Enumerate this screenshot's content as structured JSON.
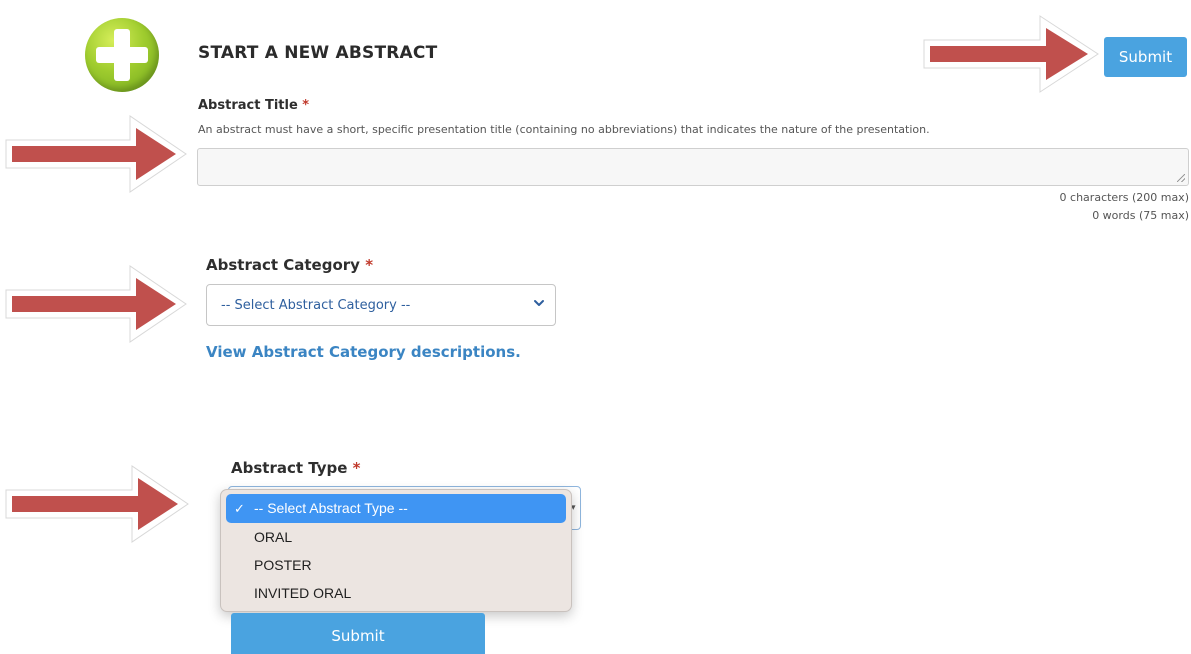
{
  "header": {
    "title": "START A NEW ABSTRACT",
    "submit_label": "Submit"
  },
  "abstract_title": {
    "label": "Abstract Title",
    "required_mark": "*",
    "help": "An abstract must have a short, specific presentation title (containing no abbreviations) that indicates the nature of the presentation.",
    "value": "",
    "char_count": "0 characters (200 max)",
    "word_count": "0 words (75 max)"
  },
  "abstract_category": {
    "label": "Abstract Category",
    "required_mark": "*",
    "selected": "-- Select Abstract Category --",
    "link": "View Abstract Category descriptions."
  },
  "abstract_type": {
    "label": "Abstract Type",
    "required_mark": "*",
    "options": [
      {
        "label": "-- Select Abstract Type --",
        "selected": true
      },
      {
        "label": "ORAL",
        "selected": false
      },
      {
        "label": "POSTER",
        "selected": false
      },
      {
        "label": "INVITED ORAL",
        "selected": false
      }
    ]
  },
  "footer": {
    "submit_label": "Submit"
  },
  "icons": {
    "logo": "plus-circle-icon",
    "check": "check-icon",
    "chevron": "chevron-down-icon",
    "annotation": "arrow-right-icon"
  },
  "colors": {
    "accent": "#4aa3e0",
    "link": "#3b85c3",
    "required": "#c0392b",
    "annotation_arrow": "#c0504d",
    "dropdown_highlight": "#3f95f3",
    "logo_green": "#9fcc2e"
  }
}
